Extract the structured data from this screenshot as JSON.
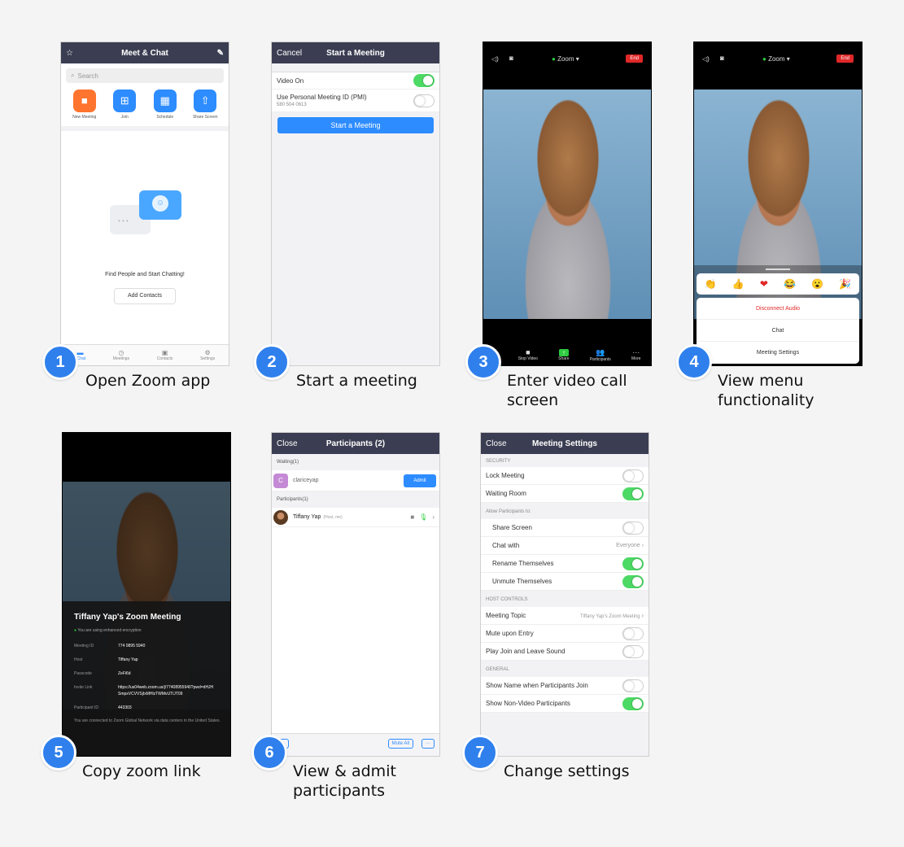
{
  "steps": [
    {
      "num": "1",
      "caption": "Open Zoom app"
    },
    {
      "num": "2",
      "caption": "Start a meeting"
    },
    {
      "num": "3",
      "caption": "Enter video call\nscreen"
    },
    {
      "num": "4",
      "caption": "View menu\nfunctionality"
    },
    {
      "num": "5",
      "caption": "Copy zoom link"
    },
    {
      "num": "6",
      "caption": "View & admit\nparticipants"
    },
    {
      "num": "7",
      "caption": "Change settings"
    }
  ],
  "p1": {
    "title": "Meet & Chat",
    "search": "Search",
    "actions": [
      "New Meeting",
      "Join",
      "Schedule",
      "Share Screen"
    ],
    "empty_text": "Find People and Start Chatting!",
    "add_contacts": "Add Contacts",
    "tabs": [
      "t Chat",
      "Meetings",
      "Contacts",
      "Settings"
    ],
    "accent": "#2d8cff",
    "orange": "#ff742e"
  },
  "p2": {
    "cancel": "Cancel",
    "title": "Start a Meeting",
    "video_on": "Video On",
    "pmi_label": "Use Personal Meeting ID (PMI)",
    "pmi_number": "580 504 0613",
    "start_btn": "Start a Meeting"
  },
  "p3": {
    "zoom_label": "Zoom",
    "end": "End",
    "toolbar": [
      "Stop Video",
      "Share",
      "Participants",
      "More"
    ]
  },
  "p4": {
    "zoom_label": "Zoom",
    "end": "End",
    "reactions": [
      "👏",
      "👍",
      "❤",
      "😂",
      "😮",
      "🎉"
    ],
    "menu": [
      "Disconnect Audio",
      "Chat",
      "Meeting Settings"
    ]
  },
  "p5": {
    "title": "Tiffany Yap's Zoom Meeting",
    "encryption": "You are using enhanced encryption",
    "rows": [
      {
        "k": "Meeting ID",
        "v": "774 0895 5940"
      },
      {
        "k": "Host",
        "v": "Tiffany Yap"
      },
      {
        "k": "Passcode",
        "v": "ZeFi6d"
      },
      {
        "k": "Invite Link",
        "v": "https://us04web.zoom.us/j/77408955940?pwd=dHJHSmpxVCVVSjIxMHlzTWMvUTlJT09"
      },
      {
        "k": "Participant ID",
        "v": "443303"
      }
    ],
    "footer": "You are connected to Zoom Global Network via data centers in the United States."
  },
  "p6": {
    "close": "Close",
    "title": "Participants (2)",
    "waiting_header": "Waiting(1)",
    "waiting_initial": "C",
    "waiting_name": "clariceyap",
    "admit": "Admit",
    "participants_header": "Participants(1)",
    "host_name": "Tiffany Yap",
    "host_tag": "(Host, me)",
    "invite_partial": "te",
    "mute_all": "Mute All",
    "more": "···"
  },
  "p7": {
    "close": "Close",
    "title": "Meeting Settings",
    "security": "SECURITY",
    "lock": "Lock Meeting",
    "waiting_room": "Waiting Room",
    "allow": "Allow Participants to:",
    "share_screen": "Share Screen",
    "chat_with": "Chat with",
    "everyone": "Everyone",
    "rename": "Rename Themselves",
    "unmute": "Unmute Themselves",
    "host_controls": "HOST CONTROLS",
    "topic": "Meeting Topic",
    "topic_value": "Tiffany Yap's Zoom Meeting",
    "mute_entry": "Mute upon Entry",
    "play_sound": "Play Join and Leave Sound",
    "general": "GENERAL",
    "show_name": "Show Name when Participants Join",
    "show_nonvideo": "Show Non-Video Participants",
    "toggle_on_color": "#4cd964"
  }
}
